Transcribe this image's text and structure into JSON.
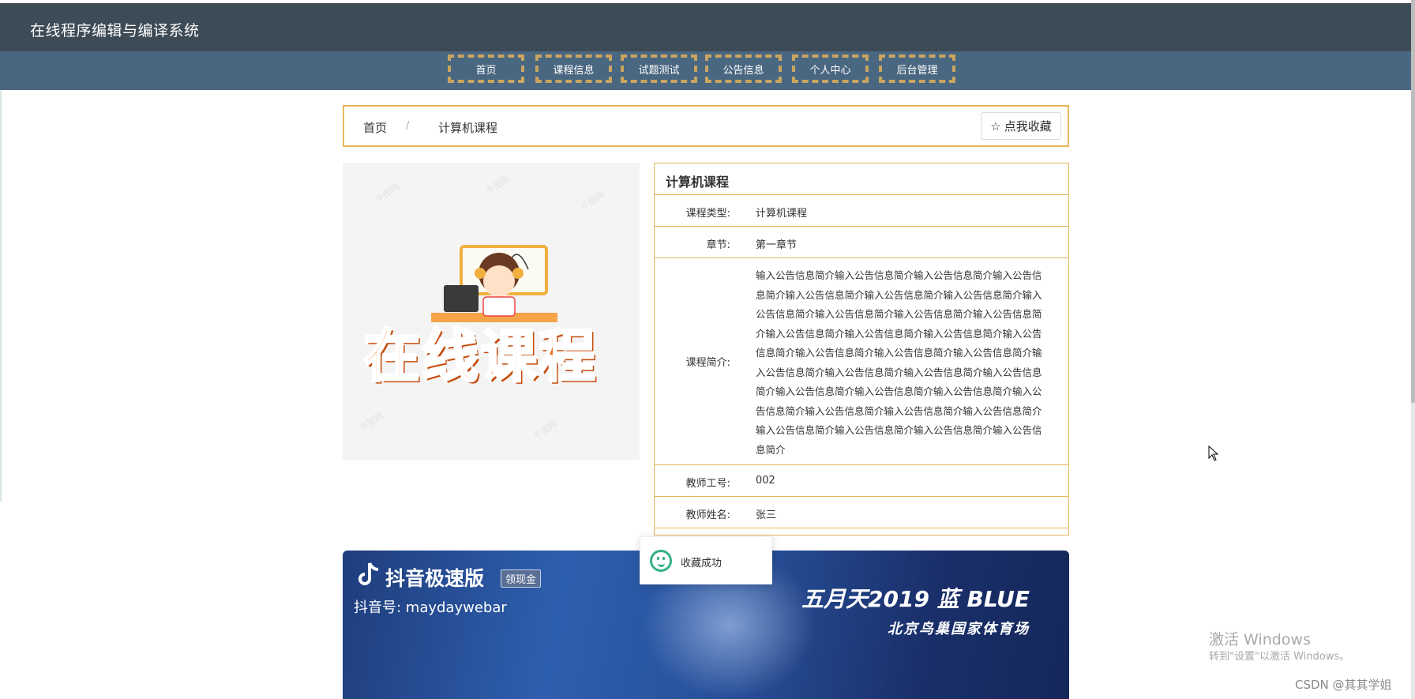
{
  "header": {
    "site_title": "在线程序编辑与编译系统"
  },
  "nav": {
    "items": [
      "首页",
      "课程信息",
      "试题测试",
      "公告信息",
      "个人中心",
      "后台管理"
    ]
  },
  "breadcrumb": {
    "home": "首页",
    "separator": "/",
    "current": "计算机课程"
  },
  "favorite": {
    "label": "点我收藏",
    "icon": "star-outline-icon"
  },
  "course_image": {
    "caption": "在线课程",
    "watermark": "千图网"
  },
  "detail": {
    "title": "计算机课程",
    "fields": [
      {
        "label": "课程类型:",
        "value": "计算机课程"
      },
      {
        "label": "章节:",
        "value": "第一章节"
      },
      {
        "label": "课程简介:",
        "value": "输入公告信息简介输入公告信息简介输入公告信息简介输入公告信息简介输入公告信息简介输入公告信息简介输入公告信息简介输入公告信息简介输入公告信息简介输入公告信息简介输入公告信息简介输入公告信息简介输入公告信息简介输入公告信息简介输入公告信息简介输入公告信息简介输入公告信息简介输入公告信息简介输入公告信息简介输入公告信息简介输入公告信息简介输入公告信息简介输入公告信息简介输入公告信息简介输入公告信息简介输入公告信息简介输入公告信息简介输入公告信息简介输入公告信息简介输入公告信息简介输入公告信息简介输入公告信息简介输入公告信息简介"
      },
      {
        "label": "教师工号:",
        "value": "002"
      },
      {
        "label": "教师姓名:",
        "value": "张三"
      }
    ]
  },
  "video": {
    "brand": "抖音极速版",
    "tag": "领现金",
    "account": "抖音号: maydaywebar",
    "concert_title": "五月天2019 蓝 BLUE",
    "concert_venue": "北京鸟巢国家体育场"
  },
  "toast": {
    "message": "收藏成功"
  },
  "system": {
    "activate_line1": "激活 Windows",
    "activate_line2": "转到\"设置\"以激活 Windows。",
    "watermark": "CSDN @其其学姐"
  },
  "colors": {
    "header_bg": "#3d4b56",
    "nav_bg": "#4a6781",
    "accent_border": "#e6b65a",
    "nav_dashed": "#c9a560",
    "success": "#35b089"
  }
}
